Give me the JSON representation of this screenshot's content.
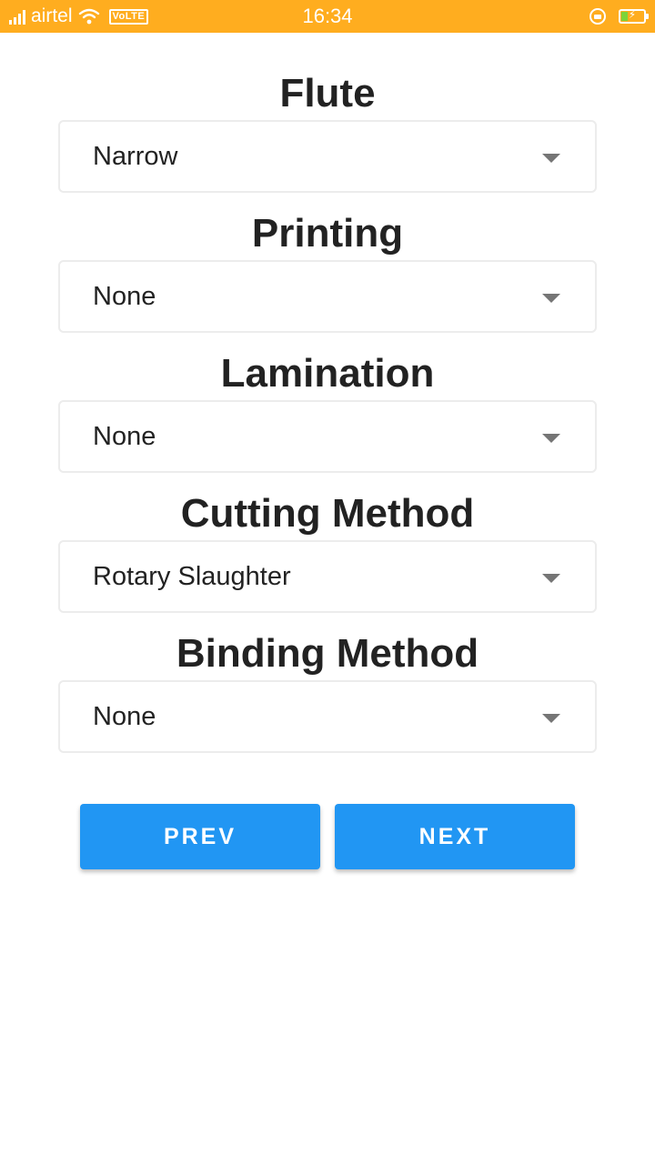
{
  "status_bar": {
    "carrier": "airtel",
    "network_badge": "VoLTE",
    "time": "16:34",
    "icons": [
      "signal-icon",
      "wifi-icon",
      "rotation-lock-icon",
      "battery-charging-icon"
    ],
    "background_color": "#ffad1f",
    "battery_fill_color": "#7cd43a"
  },
  "form": {
    "fields": [
      {
        "label": "Flute",
        "value": "Narrow"
      },
      {
        "label": "Printing",
        "value": "None"
      },
      {
        "label": "Lamination",
        "value": "None"
      },
      {
        "label": "Cutting Method",
        "value": "Rotary Slaughter"
      },
      {
        "label": "Binding Method",
        "value": "None"
      }
    ]
  },
  "buttons": {
    "prev_label": "PREV",
    "next_label": "NEXT",
    "color": "#2196f3"
  }
}
